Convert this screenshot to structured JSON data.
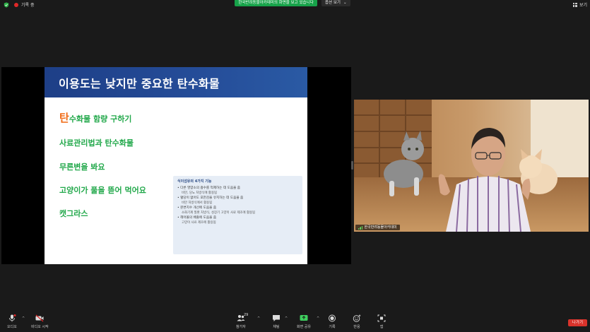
{
  "topbar": {
    "recording_label": "기록 중",
    "share_banner": "한국반려동물아카데미의 화면을 보고 있습니다",
    "view_options_label": "옵션 보기",
    "view_button_label": "보기"
  },
  "slide": {
    "title": "이용도는 낮지만 중요한 탄수화물",
    "items": [
      {
        "first": "탄",
        "rest": "수화물 함량 구하기"
      },
      {
        "first": "",
        "rest": "사료관리법과 탄수화물"
      },
      {
        "first": "",
        "rest": "무른변을 봐요"
      },
      {
        "first": "",
        "rest": "고양이가 풀을 뜯어 먹어요"
      },
      {
        "first": "",
        "rest": "캣그라스"
      }
    ],
    "info_box": {
      "title": "식이섬유의 4가지 기능",
      "rows": [
        {
          "main": "• 다른 영양소의 흡수를 억제하는 데 도움을 줌",
          "sub": "비만, 당뇨 처방식에 활용됨"
        },
        {
          "main": "• 혈당이 없어도 포만감을 유지하는 데 도움을 줌",
          "sub": "비만 처방식에서 활용됨"
        },
        {
          "main": "• 분변지수 개선에 도움을 줌",
          "sub": "소화기계 질환 처방식, 성장기 고양이 사료 제조에 활용됨"
        },
        {
          "main": "• 헤어볼의 배출에 도움을 줌",
          "sub": "고양이 사료 제조에 활용됨"
        }
      ]
    }
  },
  "video": {
    "participant_name": "한국반려동물아카데미"
  },
  "toolbar": {
    "audio_label": "오디오",
    "video_label": "비디오 시작",
    "participants_label": "참가자",
    "participants_count": "29",
    "chat_label": "채팅",
    "share_label": "화면 공유",
    "record_label": "기록",
    "reactions_label": "반응",
    "apps_label": "앱",
    "leave_label": "나가기",
    "colors": {
      "share_green": "#3fcf5f",
      "leave_red": "#d9332b"
    }
  }
}
